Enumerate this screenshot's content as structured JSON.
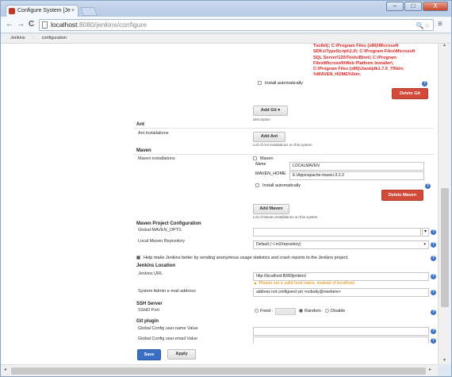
{
  "browser": {
    "tab_title": "Configure System [Je",
    "tab_close": "×",
    "url_host": "localhost",
    "url_path": ":8080/jenkins/configure",
    "back": "←",
    "forward": "→",
    "reload": "C",
    "menu": "≡",
    "omni_icons": "🔍☆",
    "window_min": "–",
    "window_max": "□",
    "window_close": "X"
  },
  "breadcrumbs": [
    "Jenkins",
    "›",
    "configuration"
  ],
  "jdk": {
    "warning_text": "Toolkit); C:\\Program Files (x86)\\Microsoft SDKs\\TypeScript\\1.0\\; C:\\Program Files\\Microsoft SQL Server\\120\\Tools\\Binn\\; C:\\Program Files\\Microsoft\\Web Platform Installer\\; C:\\Program Files (x86)\\Java\\jdk1.7.0_79\\bin; %MAVEN_HOME%\\bin.",
    "install_auto": "Install automatically",
    "delete_label": "Delete Git"
  },
  "git_add": {
    "label": "Add Git",
    "caret": "▾",
    "description": "description"
  },
  "ant": {
    "title": "Ant",
    "installations_label": "Ant installations",
    "add_label": "Add Ant",
    "list_note": "List of Ant installations on this system"
  },
  "maven": {
    "title": "Maven",
    "installations_label": "Maven installations",
    "instance_title": "Maven",
    "name_label": "Name",
    "name_value": "LOCALMAVEN",
    "home_label": "MAVEN_HOME",
    "home_value": "E:\\Apps\\apache-maven-3.3.3",
    "install_auto": "Install automatically",
    "delete_label": "Delete Maven",
    "add_label": "Add Maven",
    "list_note": "List of Maven installations on this system"
  },
  "maven_project": {
    "title": "Maven Project Configuration",
    "global_opts_label": "Global MAVEN_OPTS",
    "local_repo_label": "Local Maven Repository",
    "local_repo_value": "Default (~/.m2/repository)",
    "local_repo_caret": "▾"
  },
  "usage_stats": "Help make Jenkins better by sending anonymous usage statistics and crash reports to the Jenkins project.",
  "location": {
    "title": "Jenkins Location",
    "url_label": "Jenkins URL",
    "url_value": "http://localhost:8080/jenkins/",
    "url_warning": "Please set a valid host name, instead of localhost",
    "admin_label": "System Admin e-mail address",
    "admin_value": "address not configured yet <nobody@nowhere>"
  },
  "ssh": {
    "title": "SSH Server",
    "port_label": "SSHD Port",
    "fixed": "Fixed :",
    "random": "Random",
    "disable": "Disable"
  },
  "git_plugin": {
    "title": "Git plugin",
    "user_name_label": "Global Config user.name Value",
    "user_email_label": "Global Config user.email Value"
  },
  "actions": {
    "save": "Save",
    "apply": "Apply"
  },
  "help_glyph": "?",
  "warn_glyph": "▲"
}
